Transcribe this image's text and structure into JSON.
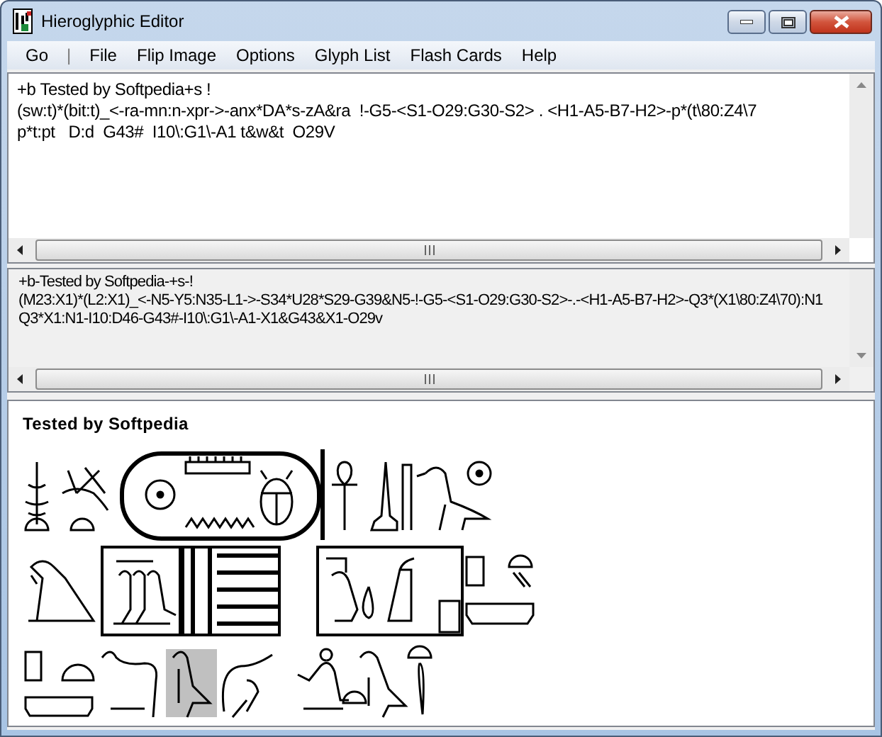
{
  "window": {
    "title": "Hieroglyphic Editor"
  },
  "menu": [
    {
      "label": "Go",
      "kind": "item"
    },
    {
      "label": "|",
      "kind": "separator"
    },
    {
      "label": "File",
      "kind": "item"
    },
    {
      "label": "Flip Image",
      "kind": "item"
    },
    {
      "label": "Options",
      "kind": "item"
    },
    {
      "label": "Glyph List",
      "kind": "item"
    },
    {
      "label": "Flash Cards",
      "kind": "item"
    },
    {
      "label": "Help",
      "kind": "item"
    }
  ],
  "source_editor": {
    "lines": [
      "+b Tested by Softpedia+s !",
      "(sw:t)*(bit:t)_<-ra-mn:n-xpr->-anx*DA*s-zA&ra  !-G5-<S1-O29:G30-S2> . <H1-A5-B7-H2>-p*(t\\80:Z4\\7",
      "p*t:pt   D:d  G43#  I10\\:G1\\-A1 t&w&t  O29V"
    ]
  },
  "encoded_view": {
    "lines": [
      "+b-Tested by Softpedia-+s-!",
      "(M23:X1)*(L2:X1)_<-N5-Y5:N35-L1->-S34*U28*S29-G39&N5-!-G5-<S1-O29:G30-S2>-.-<H1-A5-B7-H2>-Q3*(X1\\80:Z4\\70):N1",
      "Q3*X1:N1-I10:D46-G43#-I10\\:G1\\-A1-X1&G43&X1-O29v"
    ]
  },
  "rendered_view": {
    "heading": "Tested by Softpedia"
  }
}
